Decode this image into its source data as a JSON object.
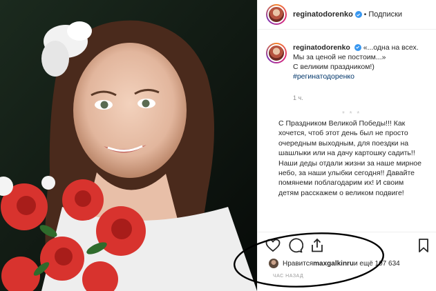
{
  "post": {
    "username": "reginatodorenko",
    "dot": "•",
    "follow_label": "Подписки",
    "caption_quote": "«...одна на всех. Мы за ценой не постоим...»",
    "caption_line": "С великим праздником!)",
    "hashtag": "#регинатодоренко",
    "caption_time": "1 ч.",
    "comment_user": "* * *",
    "comment_text": "С Праздником Великой Победы!!! Как хочется, чтоб этот день был не просто очередным выходным, для поездки на шашлыки или на дачу картошку садить!! Наши деды отдали жизни за наше мирное небо, за наши улыбки сегодня!! Давайте помянеми поблагодарим их! И своим детям расскажем о великом подвиге!",
    "likes_prefix": "Нравится ",
    "likes_user": "maxgalkinru",
    "likes_suffix": " и ещё 107 634",
    "time_ago": "ЧАС НАЗАД"
  },
  "icons": {
    "like": "heart-icon",
    "comment": "comment-icon",
    "share": "share-icon",
    "save": "bookmark-icon",
    "verified": "verified-badge-icon"
  },
  "colors": {
    "link": "#003569",
    "verified": "#3897f0",
    "muted": "#8e8e8e",
    "annotation": "#000000"
  }
}
